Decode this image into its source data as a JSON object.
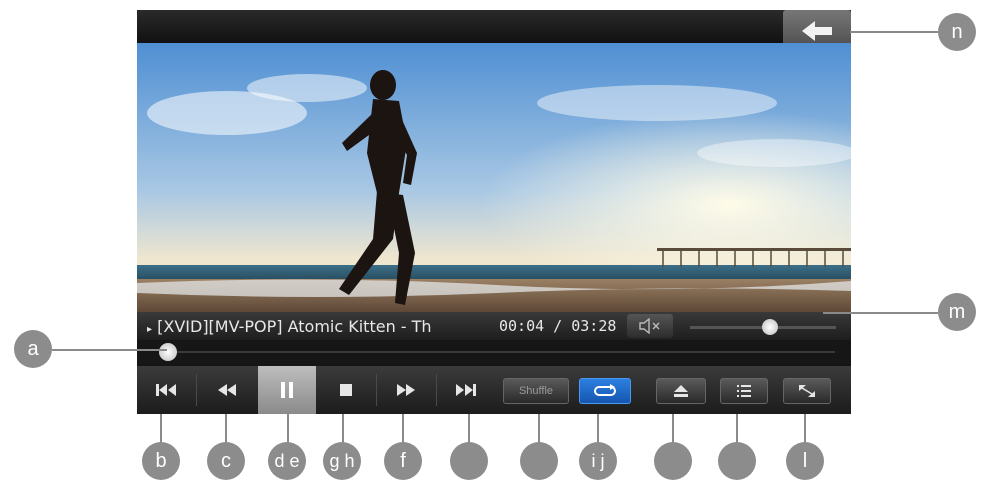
{
  "player": {
    "now_playing_title": "[XVID][MV-POP] Atomic Kitten - Th",
    "time_display": "00:04 / 03:28",
    "shuffle_label": "Shuffle",
    "progress_fraction": 0.005,
    "volume_fraction": 0.55
  },
  "colors": {
    "repeat_active": "#1e6fd0",
    "background": "#151515"
  },
  "icons": {
    "back": "back-arrow-icon",
    "mute": "speaker-mute-icon",
    "prev": "skip-previous-icon",
    "rewind": "rewind-icon",
    "pause": "pause-icon",
    "stop": "stop-icon",
    "forward": "fast-forward-icon",
    "next": "skip-next-icon",
    "repeat": "repeat-icon",
    "eject": "eject-icon",
    "playlist": "playlist-icon",
    "fullscreen": "fullscreen-icon"
  },
  "callouts": {
    "a": "a",
    "b": "b",
    "c": "c",
    "d": "d e",
    "g": "g h",
    "f": "f",
    "i": "i j",
    "l": "l",
    "m": "m",
    "n": "n"
  }
}
